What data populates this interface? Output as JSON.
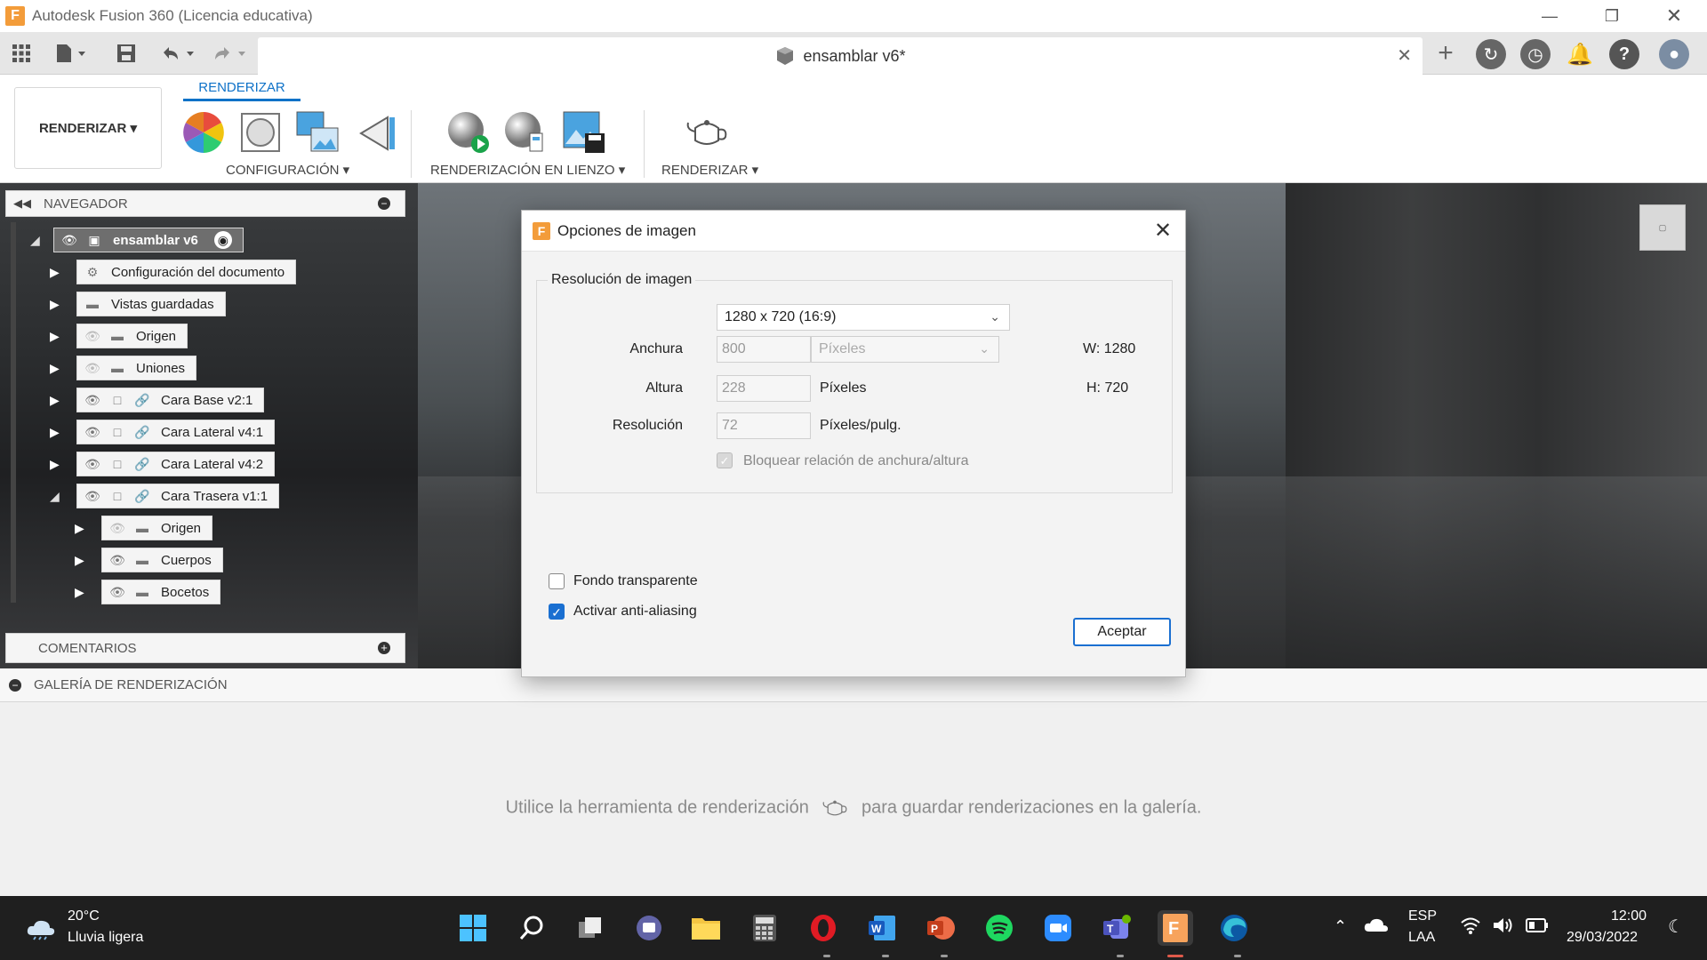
{
  "window": {
    "title": "Autodesk Fusion 360 (Licencia educativa)"
  },
  "document_tab": {
    "title": "ensamblar v6*"
  },
  "ribbon": {
    "workspace": "RENDERIZAR",
    "active_tab": "RENDERIZAR",
    "groups": [
      "CONFIGURACIÓN",
      "RENDERIZACIÓN EN LIENZO",
      "RENDERIZAR"
    ]
  },
  "navigator": {
    "title": "NAVEGADOR",
    "root": "ensamblar v6",
    "items": [
      "Configuración del documento",
      "Vistas guardadas",
      "Origen",
      "Uniones",
      "Cara Base v2:1",
      "Cara Lateral v4:1",
      "Cara Lateral v4:2",
      "Cara Trasera v1:1",
      "Origen",
      "Cuerpos",
      "Bocetos"
    ]
  },
  "comments": {
    "label": "COMENTARIOS"
  },
  "gallery": {
    "label": "GALERÍA DE RENDERIZACIÓN",
    "hint_before": "Utilice la herramienta de renderización",
    "hint_after": "para guardar renderizaciones en la galería."
  },
  "dialog": {
    "title": "Opciones de imagen",
    "group_label": "Resolución de imagen",
    "preset": "1280 x 720 (16:9)",
    "width_label": "Anchura",
    "width_value": "800",
    "width_unit": "Píxeles",
    "width_readout": "W: 1280",
    "height_label": "Altura",
    "height_value": "228",
    "height_unit": "Píxeles",
    "height_readout": "H: 720",
    "resolution_label": "Resolución",
    "resolution_value": "72",
    "resolution_unit": "Píxeles/pulg.",
    "lock_ratio_label": "Bloquear relación de anchura/altura",
    "transparent_bg_label": "Fondo transparente",
    "antialias_label": "Activar anti-aliasing",
    "ok_label": "Aceptar"
  },
  "taskbar": {
    "temperature": "20°C",
    "condition": "Lluvia ligera",
    "language_1": "ESP",
    "language_2": "LAA",
    "time": "12:00",
    "date": "29/03/2022"
  },
  "colors": {
    "accent": "#1a6fd1",
    "fusion_orange": "#f39c3a",
    "taskbar": "#1f1f1f"
  }
}
